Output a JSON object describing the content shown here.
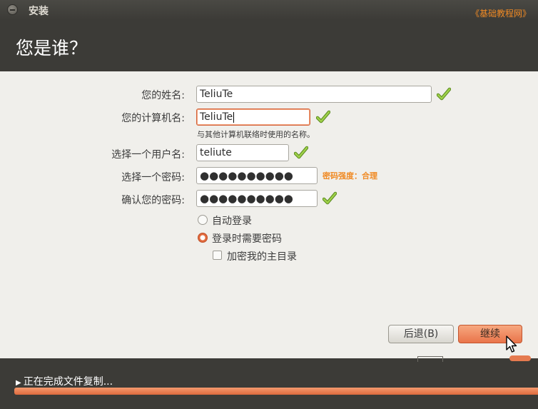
{
  "window": {
    "title": "安装",
    "watermark": "《基础教程网》"
  },
  "page": {
    "title": "您是谁？"
  },
  "form": {
    "name_label": "您的姓名:",
    "name_value": "TeliuTe",
    "computer_label": "您的计算机名:",
    "computer_value": "TeliuTe",
    "computer_hint": "与其他计算机联络时使用的名称。",
    "username_label": "选择一个用户名:",
    "username_value": "teliute",
    "password_label": "选择一个密码:",
    "password_value": "●●●●●●●●●●",
    "password_strength": "密码强度：合理",
    "confirm_label": "确认您的密码:",
    "confirm_value": "●●●●●●●●●●",
    "accent_color": "#e9744a",
    "check_color": "#8cc63f"
  },
  "options": {
    "auto_login": "自动登录",
    "require_password": "登录时需要密码",
    "encrypt_home": "加密我的主目录",
    "selected": "require_password",
    "encrypt_home_checked": false
  },
  "buttons": {
    "back": "后退(B)",
    "continue": "继续"
  },
  "progress": {
    "label": "正在完成文件复制...",
    "fraction": 1.0
  }
}
